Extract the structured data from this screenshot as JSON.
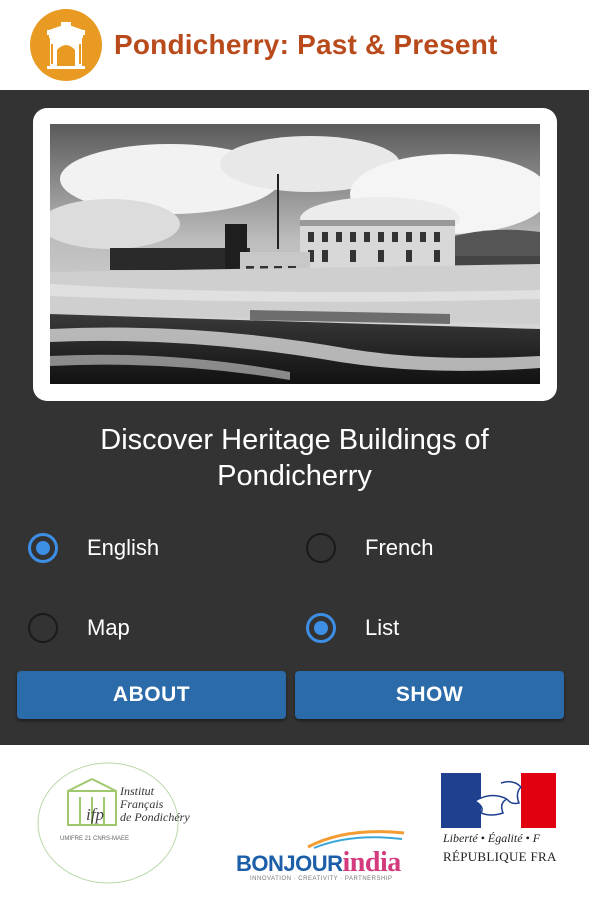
{
  "header": {
    "title": "Pondicherry: Past & Present",
    "logo_icon": "monument-arch-icon",
    "title_color": "#b94a1b",
    "logo_color": "#e99a22"
  },
  "hero": {
    "image_description_icon": "beach-heritage-photo"
  },
  "tagline": "Discover Heritage Buildings of Pondicherry",
  "options": {
    "language": [
      {
        "label": "English",
        "checked": true
      },
      {
        "label": "French",
        "checked": false
      }
    ],
    "view": [
      {
        "label": "Map",
        "checked": false
      },
      {
        "label": "List",
        "checked": true
      }
    ]
  },
  "buttons": {
    "about": "ABOUT",
    "show": "SHOW"
  },
  "footer": {
    "ifp": {
      "name": "Institut Français de Pondichéry",
      "line1": "Institut",
      "line2": "Français",
      "line3": "de Pondichéry",
      "abbr": "ifp",
      "umr": "UMIFRE 21 CNRS-MAEE"
    },
    "bonjour": {
      "part1": "BONJOUR",
      "part2": "india",
      "tagline": "INNOVATION · CREATIVITY · PARTNERSHIP"
    },
    "republique": {
      "motto": "Liberté • Égalité • F",
      "name": "RÉPUBLIQUE FRA"
    }
  },
  "colors": {
    "panel": "#333333",
    "button": "#2c6ba9",
    "radio_accent": "#3d8fe6"
  }
}
